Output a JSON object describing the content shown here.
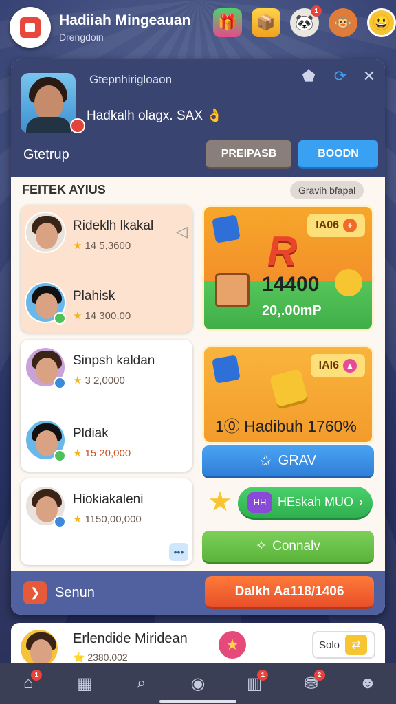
{
  "header": {
    "title": "Hadiiah Mingeauan",
    "subtitle": "Drengdoin",
    "icons": [
      {
        "name": "gift-shop-icon",
        "glyph": "🎁",
        "badge": ""
      },
      {
        "name": "treasure-icon",
        "glyph": "📦",
        "badge": ""
      },
      {
        "name": "panda-icon",
        "glyph": "🐼",
        "badge": "1"
      },
      {
        "name": "monkey-icon",
        "glyph": "🐵",
        "badge": ""
      },
      {
        "name": "emoji-icon",
        "glyph": "😃",
        "badge": ""
      }
    ]
  },
  "profile": {
    "label": "Gtepnhirigloaon",
    "info": "Hadkalh olagx. SAX 👌",
    "group": "Gtetrup",
    "buttons": {
      "pre": "PREIPASB",
      "boom": "BOODN"
    }
  },
  "section": {
    "title": "FEITEK AYIUS",
    "pill": "Gravih bfapal"
  },
  "players": [
    {
      "name": "Rideklh lkakal",
      "score": "14 5,3600",
      "status": "none"
    },
    {
      "name": "Plahisk",
      "score": "14 300,00",
      "status": "green"
    },
    {
      "name": "Sinpsh kaldan",
      "score": "3 2,0000",
      "status": "blue"
    },
    {
      "name": "Pldiak",
      "score": "15 20,000",
      "status": "green"
    },
    {
      "name": "Hiokiakaleni",
      "score": "1150,00,000",
      "status": "blue"
    }
  ],
  "promo1": {
    "badge": "IA06",
    "letter": "R",
    "value": "14400",
    "sub": "20,.00mP"
  },
  "promo2": {
    "badge": "IAI6",
    "text": "1⓪ Hadibuh 1760%"
  },
  "buttons": {
    "grav": "GRAV",
    "heskah": "HEskah MUO",
    "heskah_mini": "HH",
    "connav": "Connalv"
  },
  "footer": {
    "label": "Senun",
    "deliver": "Dalkh Aa118/1406"
  },
  "card2": {
    "name": "Erlendide Miridean",
    "score": "⭐ 2380.002",
    "solo": "Solo"
  },
  "bottom_nav": [
    {
      "name": "nav-home-icon",
      "glyph": "⌂",
      "badge": "1"
    },
    {
      "name": "nav-shop-icon",
      "glyph": "▦",
      "badge": ""
    },
    {
      "name": "nav-search-icon",
      "glyph": "⌕",
      "badge": ""
    },
    {
      "name": "nav-profile-icon",
      "glyph": "◉",
      "badge": ""
    },
    {
      "name": "nav-stats-icon",
      "glyph": "▥",
      "badge": "1"
    },
    {
      "name": "nav-rewards-icon",
      "glyph": "⛃",
      "badge": "2"
    },
    {
      "name": "nav-account-icon",
      "glyph": "☻",
      "badge": ""
    }
  ]
}
